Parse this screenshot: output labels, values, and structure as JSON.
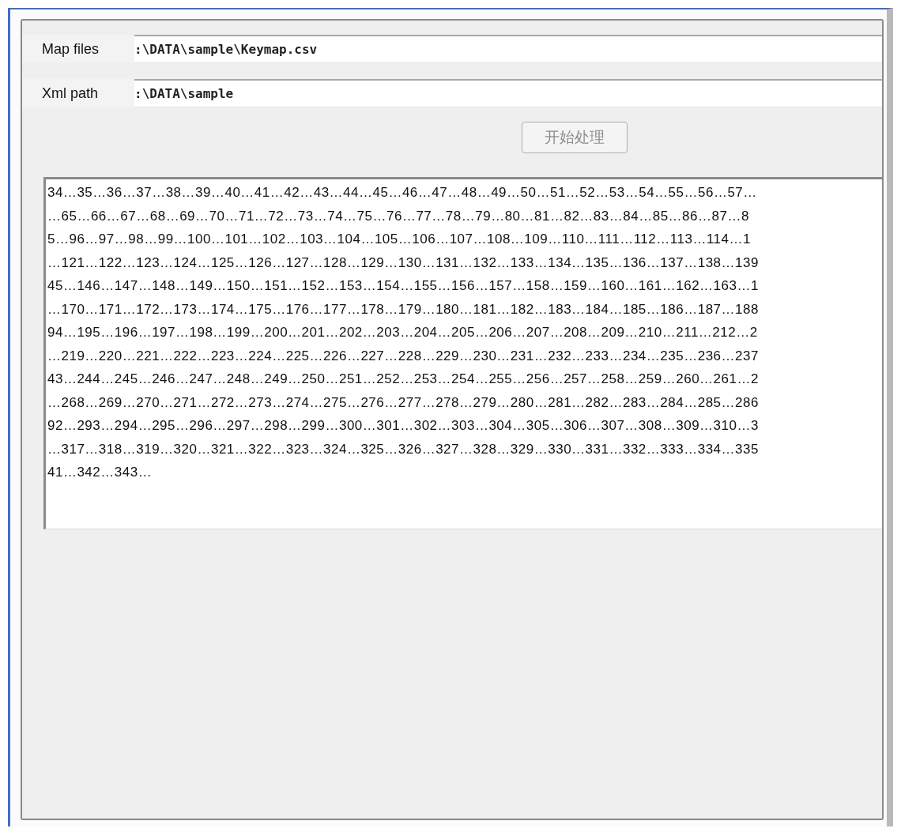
{
  "fields": [
    {
      "label": "Map files",
      "value": ":\\DATA\\sample\\Keymap.csv"
    },
    {
      "label": "Xml path",
      "value": ":\\DATA\\sample"
    }
  ],
  "button": {
    "label": "开始处理",
    "disabled": true
  },
  "output": {
    "lines": [
      "34…35…36…37…38…39…40…41…42…43…44…45…46…47…48…49…50…51…52…53…54…55…56…57…",
      "…65…66…67…68…69…70…71…72…73…74…75…76…77…78…79…80…81…82…83…84…85…86…87…8",
      "5…96…97…98…99…100…101…102…103…104…105…106…107…108…109…110…111…112…113…114…1",
      "…121…122…123…124…125…126…127…128…129…130…131…132…133…134…135…136…137…138…139",
      "45…146…147…148…149…150…151…152…153…154…155…156…157…158…159…160…161…162…163…1",
      "…170…171…172…173…174…175…176…177…178…179…180…181…182…183…184…185…186…187…188",
      "94…195…196…197…198…199…200…201…202…203…204…205…206…207…208…209…210…211…212…2",
      "…219…220…221…222…223…224…225…226…227…228…229…230…231…232…233…234…235…236…237",
      "43…244…245…246…247…248…249…250…251…252…253…254…255…256…257…258…259…260…261…2",
      "…268…269…270…271…272…273…274…275…276…277…278…279…280…281…282…283…284…285…286",
      "92…293…294…295…296…297…298…299…300…301…302…303…304…305…306…307…308…309…310…3",
      "…317…318…319…320…321…322…323…324…325…326…327…328…329…330…331…332…333…334…335",
      "41…342…343…"
    ]
  }
}
